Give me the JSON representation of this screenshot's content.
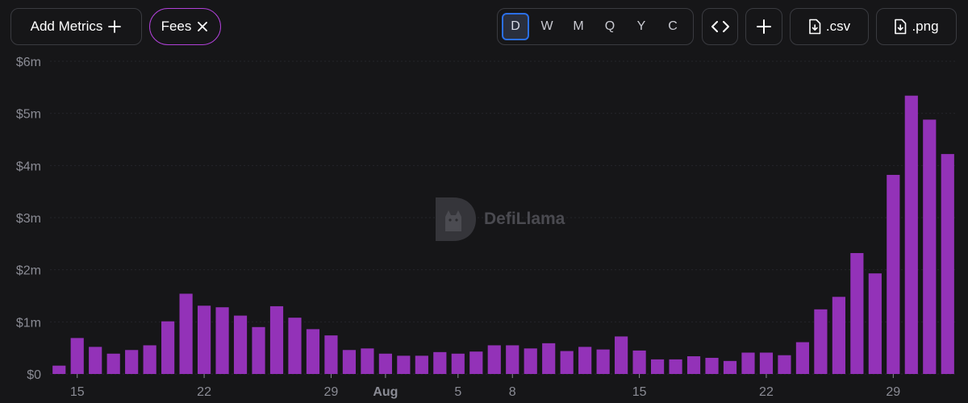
{
  "toolbar": {
    "add_metrics_label": "Add Metrics",
    "fees_label": "Fees",
    "periods": [
      {
        "label": "D",
        "active": true
      },
      {
        "label": "W",
        "active": false
      },
      {
        "label": "M",
        "active": false
      },
      {
        "label": "Q",
        "active": false
      },
      {
        "label": "Y",
        "active": false
      },
      {
        "label": "C",
        "active": false
      }
    ],
    "csv_label": ".csv",
    "png_label": ".png"
  },
  "watermark": {
    "text": "DefiLlama"
  },
  "colors": {
    "background": "#161618",
    "bar": "#9332b8",
    "axis_text": "#8a8b94",
    "accent_chip": "#b041d8",
    "active_period": "#2b6fe6"
  },
  "icons": [
    "plus-icon",
    "close-icon",
    "code-icon",
    "plus-icon",
    "file-download-icon",
    "file-download-icon",
    "defillama-logo-icon"
  ],
  "chart_data": {
    "type": "bar",
    "title": "",
    "xlabel": "",
    "ylabel": "",
    "ylim": [
      0,
      6000000
    ],
    "yticks": [
      {
        "value": 0,
        "label": "$0"
      },
      {
        "value": 1000000,
        "label": "$1m"
      },
      {
        "value": 2000000,
        "label": "$2m"
      },
      {
        "value": 3000000,
        "label": "$3m"
      },
      {
        "value": 4000000,
        "label": "$4m"
      },
      {
        "value": 5000000,
        "label": "$5m"
      },
      {
        "value": 6000000,
        "label": "$6m"
      }
    ],
    "xticks": [
      {
        "index": 1,
        "label": "15",
        "bold": false
      },
      {
        "index": 8,
        "label": "22",
        "bold": false
      },
      {
        "index": 15,
        "label": "29",
        "bold": false
      },
      {
        "index": 18,
        "label": "Aug",
        "bold": true
      },
      {
        "index": 22,
        "label": "5",
        "bold": false
      },
      {
        "index": 25,
        "label": "8",
        "bold": false
      },
      {
        "index": 32,
        "label": "15",
        "bold": false
      },
      {
        "index": 39,
        "label": "22",
        "bold": false
      },
      {
        "index": 46,
        "label": "29",
        "bold": false
      }
    ],
    "grid": true,
    "legend": "none",
    "series": [
      {
        "values": [
          160000,
          690000,
          520000,
          390000,
          460000,
          550000,
          1010000,
          1540000,
          1310000,
          1280000,
          1120000,
          900000,
          1300000,
          1080000,
          860000,
          740000,
          460000,
          490000,
          390000,
          350000,
          350000,
          420000,
          390000,
          430000,
          550000,
          550000,
          490000,
          590000,
          440000,
          520000,
          470000,
          720000,
          450000,
          280000,
          280000,
          340000,
          310000,
          250000,
          410000,
          410000,
          360000,
          610000,
          1240000,
          1480000,
          2320000,
          1930000,
          3820000,
          5340000,
          4880000,
          4220000
        ]
      }
    ]
  }
}
